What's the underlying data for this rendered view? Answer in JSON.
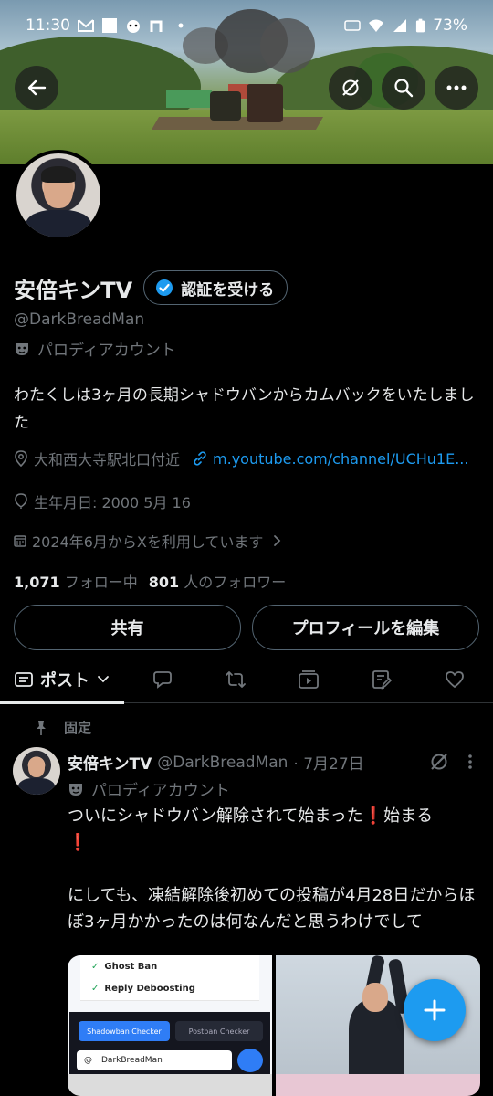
{
  "status_bar": {
    "time": "11:30",
    "battery": "73%"
  },
  "profile": {
    "name": "安倍キンTV",
    "verify_label": "認証を受ける",
    "handle": "@DarkBreadMan",
    "parody_label": "パロディアカウント",
    "bio": "わたくしは3ヶ月の長期シャドウバンからカムバックをいたしました",
    "location": "大和西大寺駅北口付近",
    "link": "m.youtube.com/channel/UCHu1E...",
    "birthday": "生年月日: 2000 5月 16",
    "joined": "2024年6月からXを利用しています",
    "following_count": "1,071",
    "following_label": "フォロー中",
    "followers_count": "801",
    "followers_label": "人のフォロワー"
  },
  "actions": {
    "share": "共有",
    "edit_profile": "プロフィールを編集"
  },
  "tabs": {
    "posts": "ポスト"
  },
  "pinned_post": {
    "pinned_label": "固定",
    "author": "安倍キンTV",
    "handle": "@DarkBreadMan",
    "date": "· 7月27日",
    "parody_label": "パロディアカウント",
    "text_line1": "ついにシャドウバン解除されて始まった",
    "text_line1b": "始まる",
    "text_para2": "にしても、凍結解除後初めての投稿が4月28日だからほぼ3ヶ月かかったのは何なんだと思うわけでして",
    "media": {
      "ghost_ban": "Ghost Ban",
      "reply_deboosting": "Reply Deboosting",
      "shadowban_checker": "Shadowban Checker",
      "postban_checker": "Postban Checker",
      "input_at": "@",
      "input_value": "DarkBreadMan"
    }
  },
  "colors": {
    "accent": "#1d9bf0",
    "background": "#000000",
    "muted": "#71767b",
    "text": "#e7e9ea"
  }
}
